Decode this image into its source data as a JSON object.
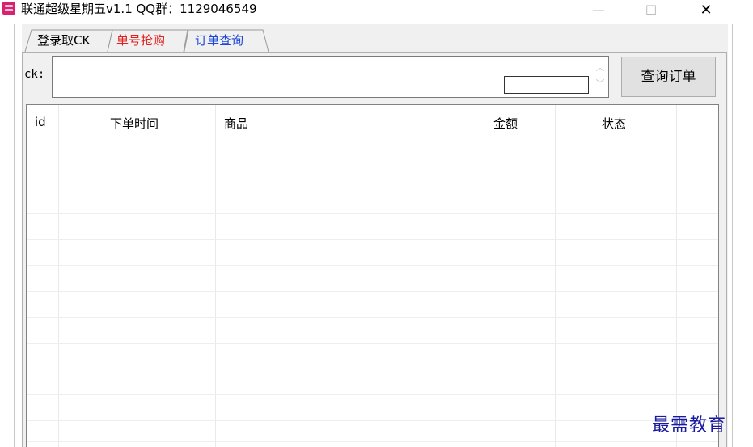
{
  "window": {
    "title": "联通超级星期五v1.1   QQ群：1129046549",
    "icon": "app-icon",
    "minimize_glyph": "—",
    "maximize_glyph": "☐",
    "close_glyph": "✕"
  },
  "tabs": [
    {
      "label": "登录取CK",
      "color": "#000000"
    },
    {
      "label": "单号抢购",
      "color": "#e02020"
    },
    {
      "label": "订单查询",
      "color": "#1c47d8",
      "selected": true
    }
  ],
  "query": {
    "ck_label": "ck:",
    "ck_value": "",
    "button_label": "查询订单"
  },
  "table": {
    "columns": [
      "id",
      "下单时间",
      "商品",
      "金额",
      "状态"
    ],
    "rows": []
  },
  "watermark": "最需教育"
}
